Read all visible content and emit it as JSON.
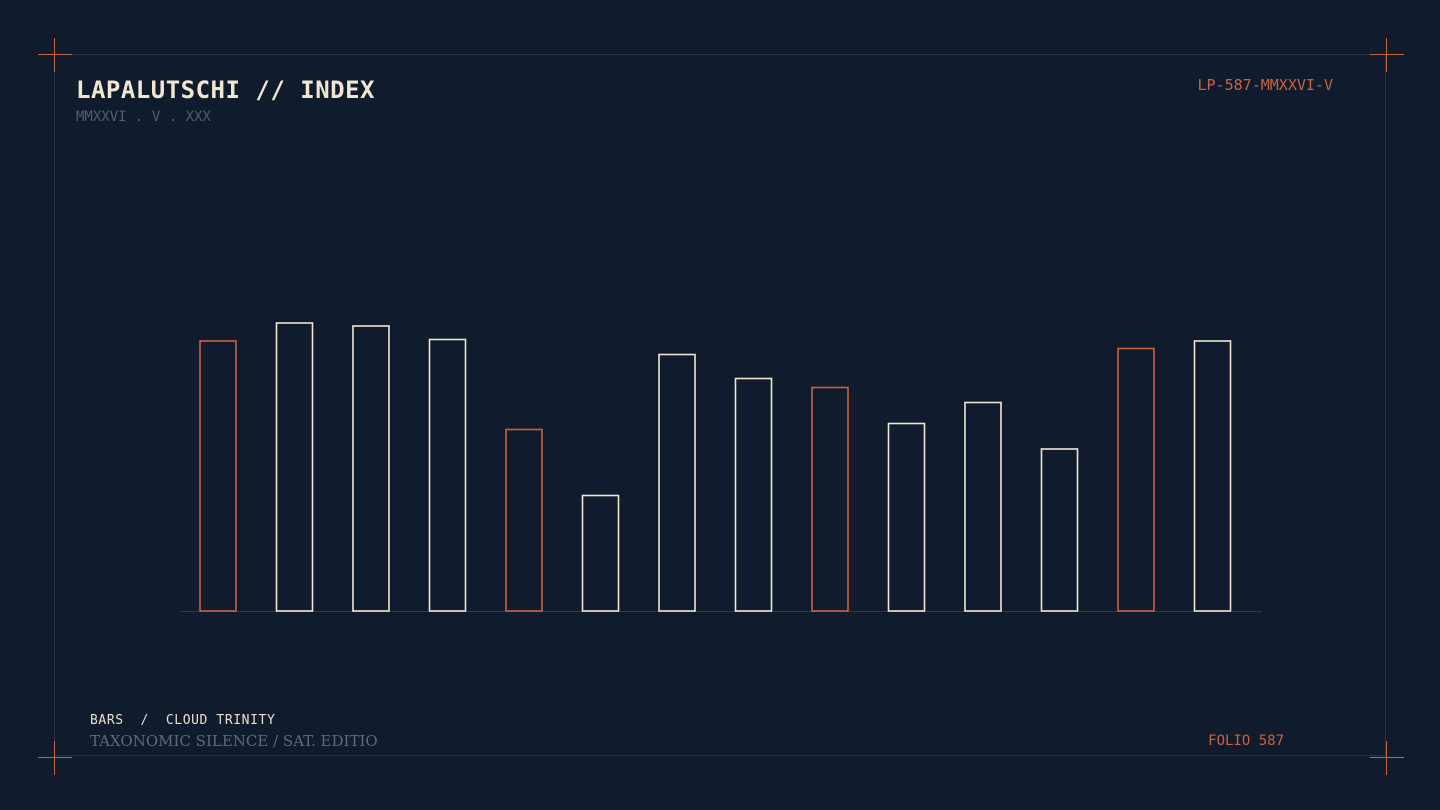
{
  "header": {
    "title": "LAPALUTSCHI // INDEX",
    "subtitle": "MMXXVI . V . XXX",
    "code": "LP-587-MMXXVI-V"
  },
  "footer": {
    "label": "BARS  /  CLOUD TRINITY",
    "sub": "TAXONOMIC SILENCE / SAT. EDITIO",
    "folio": "FOLIO 587"
  },
  "colors": {
    "background": "#101b2e",
    "accent": "#c8643c",
    "cream": "#f1e6d0",
    "frame": "#243247"
  },
  "chart_data": {
    "type": "bar",
    "categories": [
      "",
      "",
      "",
      "",
      "",
      "",
      "",
      "",
      "",
      "",
      "",
      "",
      "",
      ""
    ],
    "values": [
      90,
      96,
      95,
      90.5,
      60.5,
      38.5,
      85.5,
      77.5,
      74.5,
      62.5,
      69.5,
      54,
      87.5,
      90
    ],
    "highlight": [
      true,
      false,
      false,
      false,
      true,
      false,
      false,
      false,
      true,
      false,
      false,
      false,
      true,
      false
    ],
    "ylim": [
      0,
      100
    ],
    "grid": false,
    "xlabel": "",
    "ylabel": "",
    "title": ""
  }
}
